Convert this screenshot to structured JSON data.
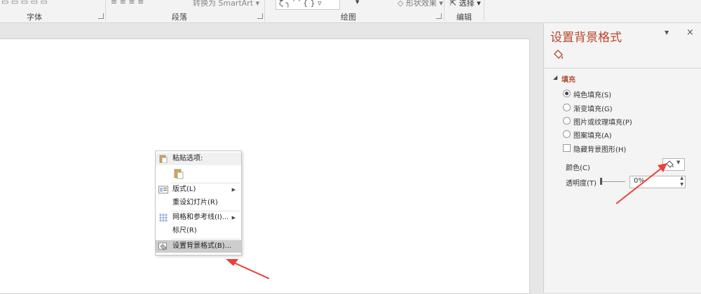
{
  "ribbon": {
    "groups": [
      {
        "label": "字体"
      },
      {
        "label": "段落"
      },
      {
        "label": "绘图"
      },
      {
        "label": "编辑"
      }
    ],
    "smartart_label": "转换为 SmartArt",
    "shape_effect_label": "形状效果",
    "select_label": "选择"
  },
  "context_menu": {
    "paste_options": "粘贴选项:",
    "layout": "版式(L)",
    "reset_slide": "重设幻灯片(R)",
    "grid_guides": "网格和参考线(I)...",
    "ruler": "标尺(R)",
    "format_background": "设置背景格式(B)..."
  },
  "pane": {
    "title": "设置背景格式",
    "fill_section": "填充",
    "options": [
      {
        "label": "纯色填充(S)",
        "selected": true
      },
      {
        "label": "渐变填充(G)",
        "selected": false
      },
      {
        "label": "图片或纹理填充(P)",
        "selected": false
      },
      {
        "label": "图案填充(A)",
        "selected": false
      }
    ],
    "hide_bg_graphics": "隐藏背景图形(H)",
    "color_label": "颜色(C)",
    "transparency_label": "透明度(T)",
    "transparency_value": "0%"
  },
  "colors": {
    "accent": "#b7472a",
    "arrow": "#e8423b"
  }
}
